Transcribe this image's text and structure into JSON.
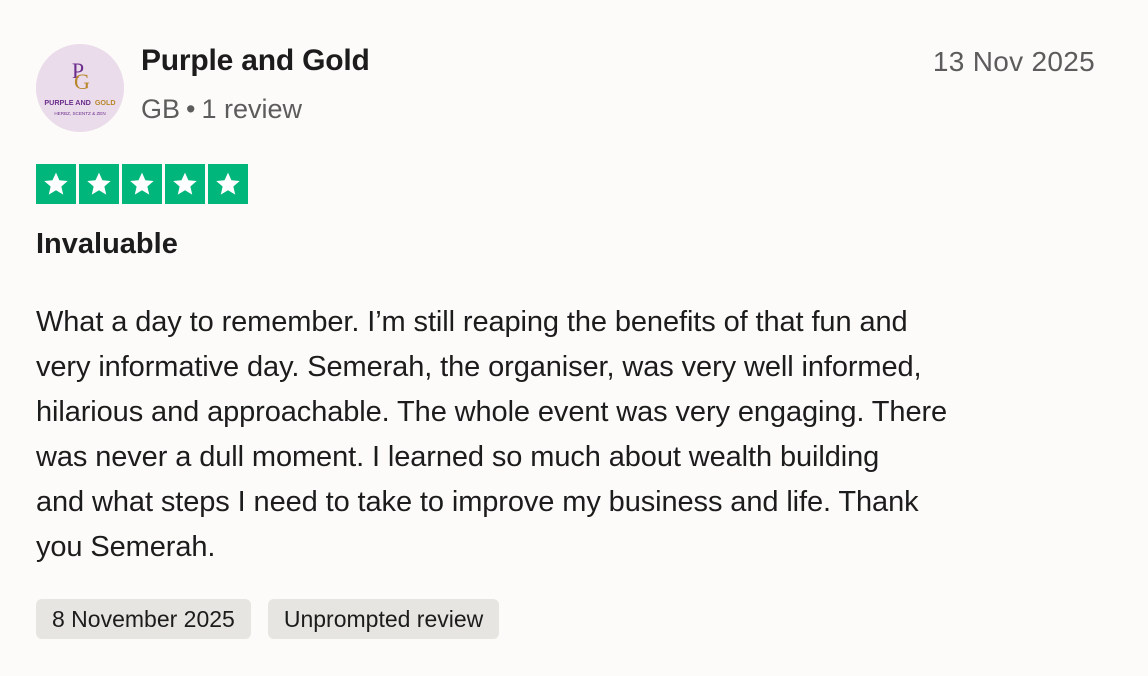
{
  "reviewer": {
    "avatar": {
      "monogram_p": "P",
      "monogram_g": "G",
      "brand_line_1_part_a": "PURPLE AND",
      "brand_line_1_part_b": "GOLD",
      "brand_line_2": "HERBZ, SCENTZ & ZEN"
    },
    "name": "Purple and Gold",
    "country": "GB",
    "separator": "•",
    "review_count": "1 review"
  },
  "review": {
    "date": "13 Nov 2025",
    "rating": 5,
    "rating_max": 5,
    "title": "Invaluable",
    "body_lines": [
      "What a day to remember. I’m still reaping the benefits of that fun and",
      "very informative day. Semerah, the organiser, was very well informed,",
      "hilarious and approachable. The whole event was very engaging. There",
      "was never a dull moment. I learned so much about wealth building",
      "and what steps I need to take to improve my business and life. Thank",
      "you Semerah."
    ],
    "experience_date": "8 November 2025",
    "review_type": "Unprompted review"
  },
  "colors": {
    "star_green": "#00b67a",
    "background": "#fcfbf9",
    "tag_background": "#e6e5e1",
    "text_primary": "#1c1c1c",
    "text_secondary": "#5c5c5c",
    "brand_purple": "#6b2d8c",
    "brand_gold": "#b8862b"
  },
  "icons": {
    "star": "star-icon"
  }
}
